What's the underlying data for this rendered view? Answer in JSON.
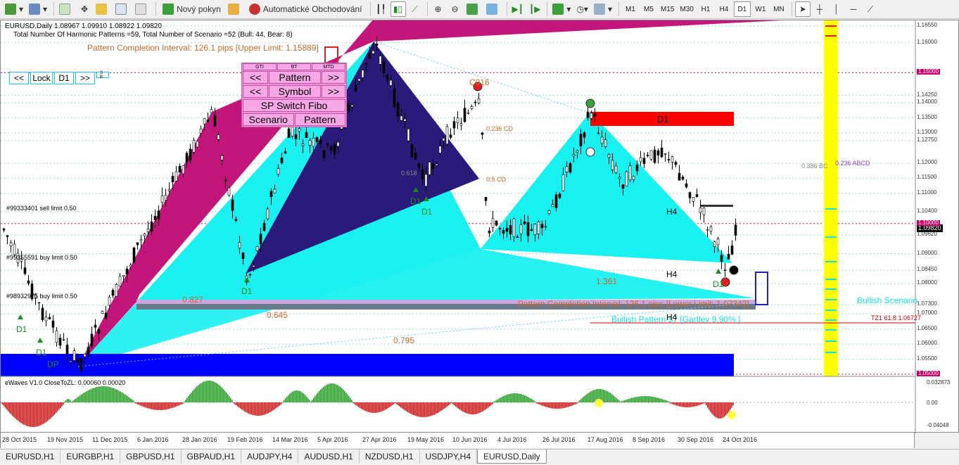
{
  "toolbar": {
    "new_order": "Nový pokyn",
    "auto_trading": "Automatické Obchodování",
    "timeframes": [
      "M1",
      "M5",
      "M15",
      "M30",
      "H1",
      "H4",
      "D1",
      "W1",
      "MN"
    ],
    "active_timeframe": "D1"
  },
  "chart": {
    "symbol_line": "EURUSD,Daily  1.08967 1.09910 1.08922 1.09820",
    "summary_line": "Total Number Of Harmonic Patterns =59, Total Number of Scenario =52 (Bull: 44, Bear: 8)",
    "completion_top": "Pattern Completion Interval: 126.1 pips [Upper Limit: 1.15889]",
    "completion_bottom": "Pattern Completion Interval: 126.1 pips [Lower Limit: 1.07342]",
    "bullish_pattern": "Bullish Pattern 57  [Gartley   9.90% ]",
    "bullish_scenario": "Bullish Scenario",
    "tz_label": "TZ1 61.8    1.06727",
    "sell_limit": "#99333401 sell limit 0.50",
    "buy_limit_1": "#99355591 buy limit 0.50",
    "buy_limit_2": "#98932975 buy limit 0.50",
    "fib_labels": {
      "r0236cd": "0.236 CD",
      "r0236abcd": "0.236 ABCD",
      "r0386bc": "0.386 BC",
      "r1361": "1.361",
      "r0827": "0.827",
      "r0645": "0.645",
      "r0795": "0.795",
      "cd_left": "0.5 CD",
      "c016": "C016",
      "r0618": "0.618"
    },
    "zone_labels": {
      "d1": "D1",
      "h4a": "H4",
      "h4b": "H4",
      "h4c": "H4"
    },
    "point_markers": [
      "D1",
      "D1",
      "D1",
      "D1",
      "D1",
      "DP",
      "D1"
    ],
    "current_price": "1.09820",
    "price_ticks": [
      "1.16550",
      "1.16000",
      "1.15000",
      "1.14250",
      "1.14000",
      "1.13500",
      "1.13000",
      "1.12750",
      "1.12000",
      "1.11500",
      "1.11000",
      "1.10400",
      "1.10000",
      "1.09620",
      "1.09000",
      "1.08450",
      "1.08000",
      "1.07300",
      "1.07000",
      "1.06500",
      "1.06000",
      "1.05500",
      "1.05000"
    ],
    "highlight_ticks": {
      "1.15000": "#cc0066",
      "1.10000": "#cc0066",
      "1.05000": "#cc0066"
    }
  },
  "nav": {
    "prev": "<<",
    "lock": "Lock",
    "tf": "D1",
    "next": ">>",
    "small": "S B"
  },
  "panel": {
    "mini": [
      "GTI",
      "BT",
      "MTD"
    ],
    "pattern_prev": "<<",
    "pattern_label": "Pattern",
    "pattern_next": ">>",
    "symbol_prev": "<<",
    "symbol_label": "Symbol",
    "symbol_next": ">>",
    "fibo": "SP Switch Fibo",
    "scenario": "Scenario",
    "pattern": "Pattern"
  },
  "indicator": {
    "title": "eWaves V1.0 CloseToZL: 0.00060 0.00020",
    "ticks": [
      "0.032873",
      "0.00",
      "-0.04048"
    ]
  },
  "time_axis": [
    "28 Oct 2015",
    "19 Nov 2015",
    "11 Dec 2015",
    "6 Jan 2016",
    "28 Jan 2016",
    "19 Feb 2016",
    "14 Mar 2016",
    "5 Apr 2016",
    "27 Apr 2016",
    "19 May 2016",
    "10 Jun 2016",
    "4 Jul 2016",
    "26 Jul 2016",
    "17 Aug 2016",
    "8 Sep 2016",
    "30 Sep 2016",
    "24 Oct 2016"
  ],
  "tabs": [
    "EURUSD,H1",
    "EURGBP,H1",
    "GBPUSD,H1",
    "GBPAUD,H1",
    "AUDJPY,H4",
    "AUDUSD,H1",
    "NZDUSD,H1",
    "USDJPY,H4",
    "EURUSD,Daily"
  ],
  "active_tab": "EURUSD,Daily",
  "colors": {
    "magenta": "#c2167a",
    "navy": "#2a1a7a",
    "cyan": "#19f0f0",
    "blue_bar": "#0000ff",
    "red_zone": "#ff0000",
    "yellow": "#ffff00",
    "candle_green": "#00a000"
  }
}
